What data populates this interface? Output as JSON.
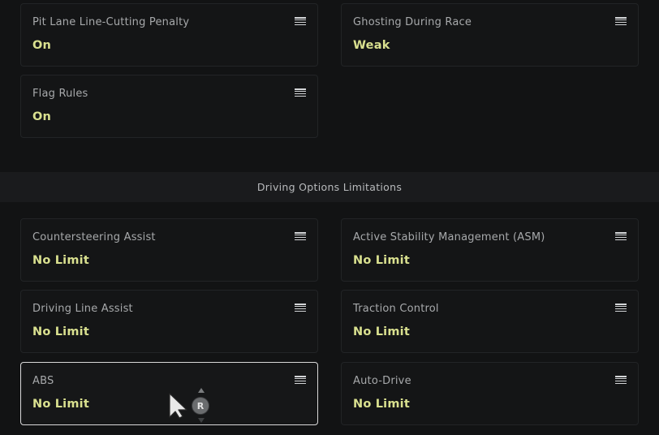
{
  "top_settings": [
    {
      "label": "Pit Lane Line-Cutting Penalty",
      "value": "On"
    },
    {
      "label": "Ghosting During Race",
      "value": "Weak"
    },
    {
      "label": "Flag Rules",
      "value": "On"
    }
  ],
  "section": {
    "title": "Driving Options Limitations"
  },
  "driving_options": [
    {
      "label": "Countersteering Assist",
      "value": "No Limit"
    },
    {
      "label": "Active Stability Management (ASM)",
      "value": "No Limit"
    },
    {
      "label": "Driving Line Assist",
      "value": "No Limit"
    },
    {
      "label": "Traction Control",
      "value": "No Limit"
    },
    {
      "label": "ABS",
      "value": "No Limit"
    },
    {
      "label": "Auto-Drive",
      "value": "No Limit"
    }
  ],
  "cursor_hint": {
    "button_label": "R"
  },
  "colors": {
    "value_accent": "#d9e08f",
    "label": "#a7a9ab",
    "background": "#121314",
    "selected_border": "#d9d9d9"
  }
}
